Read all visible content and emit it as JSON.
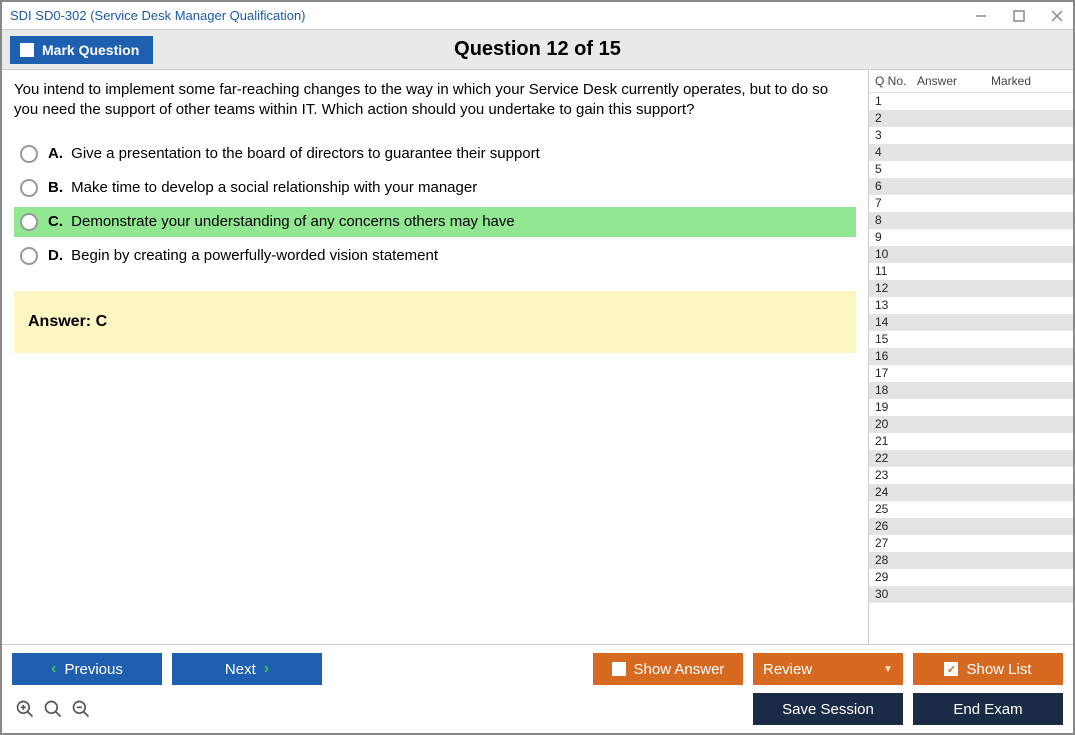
{
  "window": {
    "title": "SDI SD0-302 (Service Desk Manager Qualification)"
  },
  "header": {
    "mark_label": "Mark Question",
    "question_title": "Question 12 of 15"
  },
  "question": {
    "text": "You intend to implement some far-reaching changes to the way in which your Service Desk currently operates, but to do so you need the support of other teams within IT. Which action should you undertake to gain this support?",
    "options": [
      {
        "letter": "A.",
        "text": "Give a presentation to the board of directors to guarantee their support",
        "selected": false
      },
      {
        "letter": "B.",
        "text": "Make time to develop a social relationship with your manager",
        "selected": false
      },
      {
        "letter": "C.",
        "text": "Demonstrate your understanding of any concerns others may have",
        "selected": true
      },
      {
        "letter": "D.",
        "text": "Begin by creating a powerfully-worded vision statement",
        "selected": false
      }
    ],
    "answer_label": "Answer: C"
  },
  "sidebar": {
    "col_qno": "Q No.",
    "col_answer": "Answer",
    "col_marked": "Marked",
    "rows": [
      "1",
      "2",
      "3",
      "4",
      "5",
      "6",
      "7",
      "8",
      "9",
      "10",
      "11",
      "12",
      "13",
      "14",
      "15",
      "16",
      "17",
      "18",
      "19",
      "20",
      "21",
      "22",
      "23",
      "24",
      "25",
      "26",
      "27",
      "28",
      "29",
      "30"
    ]
  },
  "footer": {
    "previous": "Previous",
    "next": "Next",
    "show_answer": "Show Answer",
    "review": "Review",
    "show_list": "Show List",
    "save_session": "Save Session",
    "end_exam": "End Exam"
  }
}
